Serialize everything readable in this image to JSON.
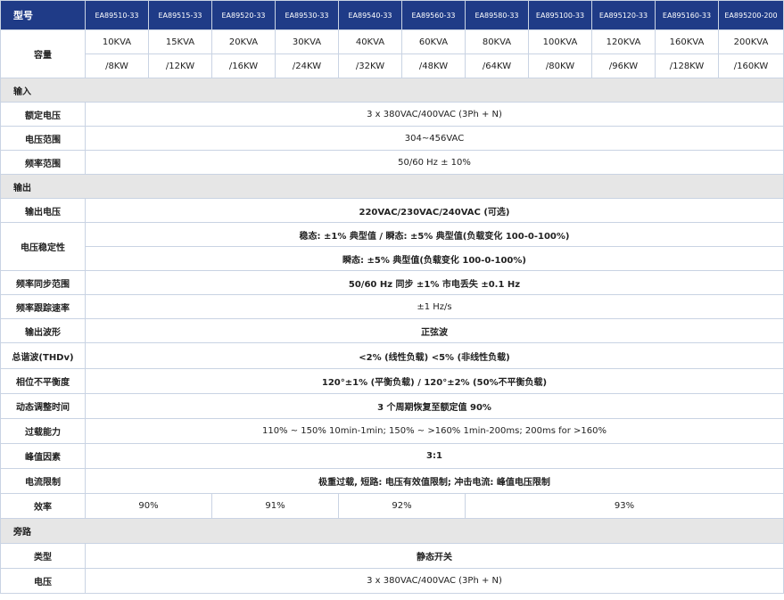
{
  "header": {
    "label": "型号",
    "models": [
      "EA89510-33",
      "EA89515-33",
      "EA89520-33",
      "EA89530-33",
      "EA89540-33",
      "EA89560-33",
      "EA89580-33",
      "EA895100-33",
      "EA895120-33",
      "EA895160-33",
      "EA895200-200"
    ]
  },
  "capacity": {
    "label": "容量",
    "kva": [
      "10KVA",
      "15KVA",
      "20KVA",
      "30KVA",
      "40KVA",
      "60KVA",
      "80KVA",
      "100KVA",
      "120KVA",
      "160KVA",
      "200KVA"
    ],
    "kw": [
      "/8KW",
      "/12KW",
      "/16KW",
      "/24KW",
      "/32KW",
      "/48KW",
      "/64KW",
      "/80KW",
      "/96KW",
      "/128KW",
      "/160KW"
    ]
  },
  "input": {
    "section": "输入",
    "rated_voltage": {
      "label": "额定电压",
      "value": "3 x 380VAC/400VAC (3Ph + N)"
    },
    "voltage_range": {
      "label": "电压范围",
      "value": "304~456VAC"
    },
    "frequency_range": {
      "label": "频率范围",
      "value": "50/60 Hz ± 10%"
    }
  },
  "output": {
    "section": "输出",
    "output_voltage": {
      "label": "输出电压",
      "value": "220VAC/230VAC/240VAC (可选)"
    },
    "voltage_stability": {
      "label": "电压稳定性",
      "value1": "稳态: ±1% 典型值 / 瞬态: ±5% 典型值(负载变化 100-0-100%)",
      "value2": "瞬态: ±5% 典型值(负载变化 100-0-100%)"
    },
    "frequency_sync": {
      "label": "频率同步范围",
      "value": "50/60 Hz 同步 ±1% 市电丢失 ±0.1 Hz"
    },
    "frequency_slew": {
      "label": "频率跟踪速率",
      "value": "±1 Hz/s"
    },
    "waveform": {
      "label": "输出波形",
      "value": "正弦波"
    },
    "thd": {
      "label": "总谐波(THDv)",
      "value": "<2% (线性负载) <5% (非线性负载)"
    },
    "phase_unbalance": {
      "label": "相位不平衡度",
      "value": "120°±1% (平衡负载) / 120°±2% (50%不平衡负载)"
    },
    "dynamic": {
      "label": "动态调整时间",
      "value": "3 个周期恢复至额定值 90%"
    },
    "overload": {
      "label": "过载能力",
      "value": "110% ~ 150% 10min-1min; 150% ~ >160% 1min-200ms; 200ms for >160%"
    },
    "crest": {
      "label": "峰值因素",
      "value": "3:1"
    },
    "current_limit": {
      "label": "电流限制",
      "value": "极重过载, 短路: 电压有效值限制; 冲击电流: 峰值电压限制"
    },
    "efficiency": {
      "label": "效率",
      "values": [
        "90%",
        "91%",
        "92%",
        "93%"
      ]
    }
  },
  "bypass": {
    "section": "旁路",
    "type": {
      "label": "类型",
      "value": "静态开关"
    },
    "voltage": {
      "label": "电压",
      "value": "3 x 380VAC/400VAC (3Ph + N)"
    }
  }
}
